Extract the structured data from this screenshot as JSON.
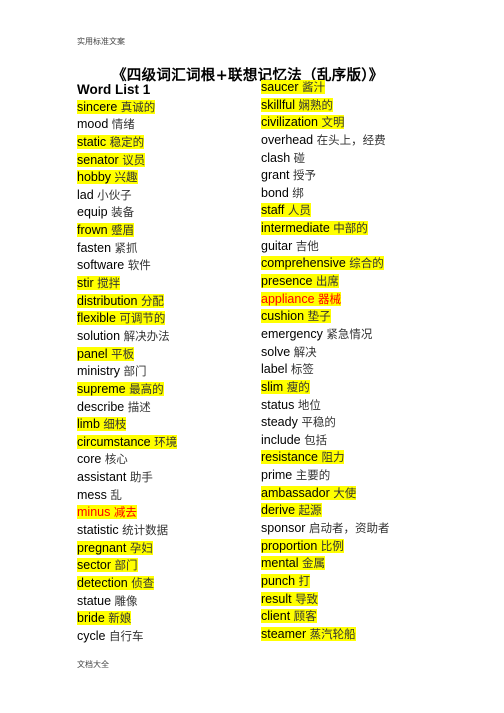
{
  "header": "实用标准文案",
  "footer": "文档大全",
  "title": "《四级词汇词根+联想记忆法（乱序版）》",
  "list_title": "Word List 1",
  "colors": {
    "highlight": "#ffff00",
    "red_text": "#ff0000"
  },
  "left_column": [
    {
      "en": "sincere",
      "zh": "真诚的",
      "highlight": true,
      "red": false
    },
    {
      "en": "mood",
      "zh": "情绪",
      "highlight": false,
      "red": false
    },
    {
      "en": "static",
      "zh": "稳定的",
      "highlight": true,
      "red": false
    },
    {
      "en": "senator",
      "zh": "议员",
      "highlight": true,
      "red": false
    },
    {
      "en": "hobby",
      "zh": "兴趣",
      "highlight": true,
      "red": false
    },
    {
      "en": "lad",
      "zh": "小伙子",
      "highlight": false,
      "red": false
    },
    {
      "en": "equip",
      "zh": "装备",
      "highlight": false,
      "red": false
    },
    {
      "en": "frown",
      "zh": "蹙眉",
      "highlight": true,
      "red": false
    },
    {
      "en": "fasten",
      "zh": "紧抓",
      "highlight": false,
      "red": false
    },
    {
      "en": "software",
      "zh": "软件",
      "highlight": false,
      "red": false
    },
    {
      "en": "stir",
      "zh": "搅拌",
      "highlight": true,
      "red": false
    },
    {
      "en": "distribution",
      "zh": "分配",
      "highlight": true,
      "red": false
    },
    {
      "en": "flexible",
      "zh": "可调节的",
      "highlight": true,
      "red": false
    },
    {
      "en": "solution",
      "zh": "解决办法",
      "highlight": false,
      "red": false
    },
    {
      "en": "panel",
      "zh": "平板",
      "highlight": true,
      "red": false
    },
    {
      "en": "ministry",
      "zh": "部门",
      "highlight": false,
      "red": false
    },
    {
      "en": "supreme",
      "zh": "最高的",
      "highlight": true,
      "red": false
    },
    {
      "en": "describe",
      "zh": "描述",
      "highlight": false,
      "red": false
    },
    {
      "en": "limb",
      "zh": "细枝",
      "highlight": true,
      "red": false
    },
    {
      "en": "circumstance",
      "zh": "环境",
      "highlight": true,
      "red": false
    },
    {
      "en": "core",
      "zh": "核心",
      "highlight": false,
      "red": false
    },
    {
      "en": "assistant",
      "zh": "助手",
      "highlight": false,
      "red": false
    },
    {
      "en": "mess",
      "zh": "乱",
      "highlight": false,
      "red": false
    },
    {
      "en": "minus",
      "zh": "减去",
      "highlight": true,
      "red": true
    },
    {
      "en": "statistic",
      "zh": "统计数据",
      "highlight": false,
      "red": false
    },
    {
      "en": "pregnant",
      "zh": "孕妇",
      "highlight": true,
      "red": false
    },
    {
      "en": "sector",
      "zh": "部门",
      "highlight": true,
      "red": false
    },
    {
      "en": "detection",
      "zh": "侦查",
      "highlight": true,
      "red": false
    },
    {
      "en": "statue",
      "zh": "雕像",
      "highlight": false,
      "red": false
    },
    {
      "en": "bride",
      "zh": "新娘",
      "highlight": true,
      "red": false
    },
    {
      "en": "cycle",
      "zh": "自行车",
      "highlight": false,
      "red": false
    }
  ],
  "right_column": [
    {
      "en": "saucer",
      "zh": "酱汁",
      "highlight": true,
      "red": false
    },
    {
      "en": "skillful",
      "zh": "娴熟的",
      "highlight": true,
      "red": false
    },
    {
      "en": "civilization",
      "zh": "文明",
      "highlight": true,
      "red": false
    },
    {
      "en": "overhead",
      "zh": "在头上，经费",
      "highlight": false,
      "red": false
    },
    {
      "en": "clash",
      "zh": "碰",
      "highlight": false,
      "red": false
    },
    {
      "en": "grant",
      "zh": "授予",
      "highlight": false,
      "red": false
    },
    {
      "en": "bond",
      "zh": "绑",
      "highlight": false,
      "red": false
    },
    {
      "en": "staff",
      "zh": "人员",
      "highlight": true,
      "red": false
    },
    {
      "en": "intermediate",
      "zh": "中部的",
      "highlight": true,
      "red": false
    },
    {
      "en": "guitar",
      "zh": "吉他",
      "highlight": false,
      "red": false
    },
    {
      "en": "comprehensive",
      "zh": "综合的",
      "highlight": true,
      "red": false
    },
    {
      "en": "presence",
      "zh": "出席",
      "highlight": true,
      "red": false
    },
    {
      "en": "appliance",
      "zh": "器械",
      "highlight": true,
      "red": true
    },
    {
      "en": "cushion",
      "zh": "垫子",
      "highlight": true,
      "red": false
    },
    {
      "en": "emergency",
      "zh": "紧急情况",
      "highlight": false,
      "red": false
    },
    {
      "en": "solve",
      "zh": "解决",
      "highlight": false,
      "red": false
    },
    {
      "en": "label",
      "zh": "标签",
      "highlight": false,
      "red": false
    },
    {
      "en": "slim",
      "zh": "瘦的",
      "highlight": true,
      "red": false
    },
    {
      "en": "status",
      "zh": "地位",
      "highlight": false,
      "red": false
    },
    {
      "en": "steady",
      "zh": "平稳的",
      "highlight": false,
      "red": false
    },
    {
      "en": "include",
      "zh": "包括",
      "highlight": false,
      "red": false
    },
    {
      "en": "resistance",
      "zh": "阻力",
      "highlight": true,
      "red": false
    },
    {
      "en": "prime",
      "zh": "主要的",
      "highlight": false,
      "red": false
    },
    {
      "en": "ambassador",
      "zh": "大使",
      "highlight": true,
      "red": false
    },
    {
      "en": "derive",
      "zh": "起源",
      "highlight": true,
      "red": false
    },
    {
      "en": "sponsor",
      "zh": "启动者，资助者",
      "highlight": false,
      "red": false
    },
    {
      "en": "proportion",
      "zh": "比例",
      "highlight": true,
      "red": false
    },
    {
      "en": "mental",
      "zh": "金属",
      "highlight": true,
      "red": false
    },
    {
      "en": "punch",
      "zh": "打",
      "highlight": true,
      "red": false
    },
    {
      "en": "result",
      "zh": "导致",
      "highlight": true,
      "red": false
    },
    {
      "en": "client",
      "zh": "顾客",
      "highlight": true,
      "red": false
    },
    {
      "en": "steamer",
      "zh": "蒸汽轮船",
      "highlight": true,
      "red": false
    }
  ]
}
